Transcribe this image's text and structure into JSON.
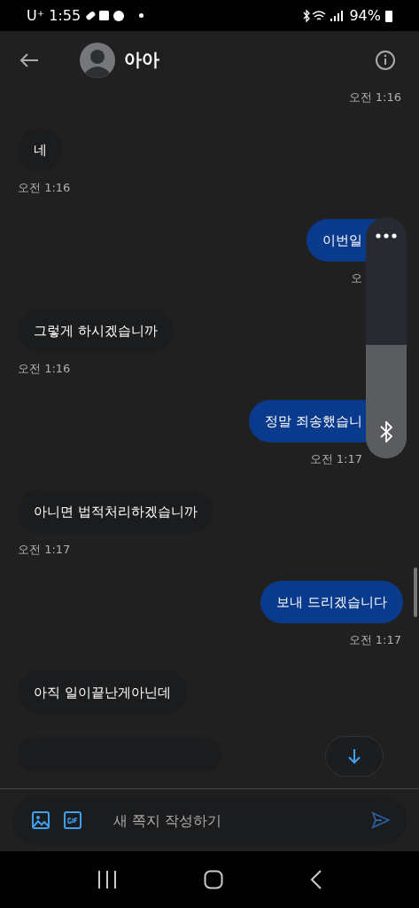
{
  "status_bar": {
    "carrier": "U⁺",
    "time": "1:55",
    "battery": "94%"
  },
  "header": {
    "title": "아아"
  },
  "top_time": "오전 1:16",
  "messages": [
    {
      "sent": false,
      "text": "네",
      "time": "오전 1:16",
      "covered": false
    },
    {
      "sent": true,
      "text": "이번일",
      "time": "오",
      "covered": true
    },
    {
      "sent": false,
      "text": "그렇게 하시겠습니까",
      "time": "오전 1:16",
      "covered": false
    },
    {
      "sent": true,
      "text": "정말 죄송했습니",
      "time": "오전 1:17",
      "covered": true
    },
    {
      "sent": false,
      "text": "아니면 법적처리하겠습니까",
      "time": "오전 1:17",
      "covered": false
    },
    {
      "sent": true,
      "text": "보내 드리겠습니다",
      "time": "오전 1:17",
      "covered": false
    },
    {
      "sent": false,
      "text": "아직 일이끝난게아닌데",
      "covered": false
    }
  ],
  "volume_panel": {
    "level": 0.47
  },
  "composer": {
    "placeholder": "새 쪽지 작성하기"
  }
}
